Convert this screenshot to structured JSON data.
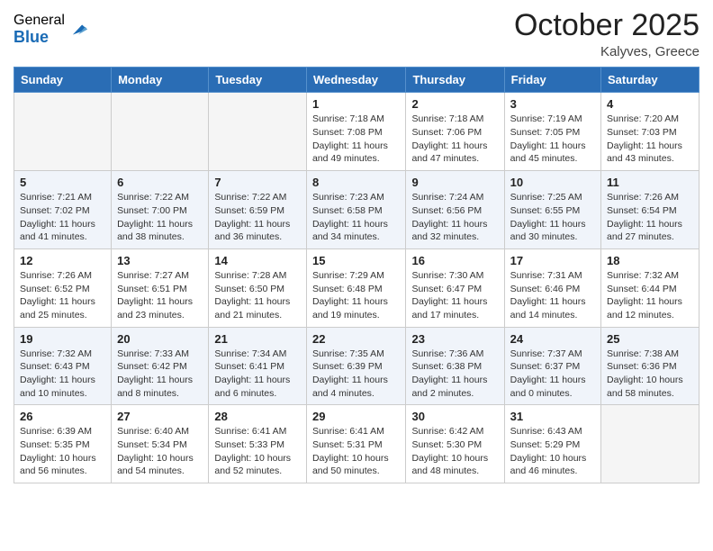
{
  "logo": {
    "general": "General",
    "blue": "Blue"
  },
  "header": {
    "month": "October 2025",
    "location": "Kalyves, Greece"
  },
  "weekdays": [
    "Sunday",
    "Monday",
    "Tuesday",
    "Wednesday",
    "Thursday",
    "Friday",
    "Saturday"
  ],
  "weeks": [
    [
      {
        "day": "",
        "sunrise": "",
        "sunset": "",
        "daylight": ""
      },
      {
        "day": "",
        "sunrise": "",
        "sunset": "",
        "daylight": ""
      },
      {
        "day": "",
        "sunrise": "",
        "sunset": "",
        "daylight": ""
      },
      {
        "day": "1",
        "sunrise": "Sunrise: 7:18 AM",
        "sunset": "Sunset: 7:08 PM",
        "daylight": "Daylight: 11 hours and 49 minutes."
      },
      {
        "day": "2",
        "sunrise": "Sunrise: 7:18 AM",
        "sunset": "Sunset: 7:06 PM",
        "daylight": "Daylight: 11 hours and 47 minutes."
      },
      {
        "day": "3",
        "sunrise": "Sunrise: 7:19 AM",
        "sunset": "Sunset: 7:05 PM",
        "daylight": "Daylight: 11 hours and 45 minutes."
      },
      {
        "day": "4",
        "sunrise": "Sunrise: 7:20 AM",
        "sunset": "Sunset: 7:03 PM",
        "daylight": "Daylight: 11 hours and 43 minutes."
      }
    ],
    [
      {
        "day": "5",
        "sunrise": "Sunrise: 7:21 AM",
        "sunset": "Sunset: 7:02 PM",
        "daylight": "Daylight: 11 hours and 41 minutes."
      },
      {
        "day": "6",
        "sunrise": "Sunrise: 7:22 AM",
        "sunset": "Sunset: 7:00 PM",
        "daylight": "Daylight: 11 hours and 38 minutes."
      },
      {
        "day": "7",
        "sunrise": "Sunrise: 7:22 AM",
        "sunset": "Sunset: 6:59 PM",
        "daylight": "Daylight: 11 hours and 36 minutes."
      },
      {
        "day": "8",
        "sunrise": "Sunrise: 7:23 AM",
        "sunset": "Sunset: 6:58 PM",
        "daylight": "Daylight: 11 hours and 34 minutes."
      },
      {
        "day": "9",
        "sunrise": "Sunrise: 7:24 AM",
        "sunset": "Sunset: 6:56 PM",
        "daylight": "Daylight: 11 hours and 32 minutes."
      },
      {
        "day": "10",
        "sunrise": "Sunrise: 7:25 AM",
        "sunset": "Sunset: 6:55 PM",
        "daylight": "Daylight: 11 hours and 30 minutes."
      },
      {
        "day": "11",
        "sunrise": "Sunrise: 7:26 AM",
        "sunset": "Sunset: 6:54 PM",
        "daylight": "Daylight: 11 hours and 27 minutes."
      }
    ],
    [
      {
        "day": "12",
        "sunrise": "Sunrise: 7:26 AM",
        "sunset": "Sunset: 6:52 PM",
        "daylight": "Daylight: 11 hours and 25 minutes."
      },
      {
        "day": "13",
        "sunrise": "Sunrise: 7:27 AM",
        "sunset": "Sunset: 6:51 PM",
        "daylight": "Daylight: 11 hours and 23 minutes."
      },
      {
        "day": "14",
        "sunrise": "Sunrise: 7:28 AM",
        "sunset": "Sunset: 6:50 PM",
        "daylight": "Daylight: 11 hours and 21 minutes."
      },
      {
        "day": "15",
        "sunrise": "Sunrise: 7:29 AM",
        "sunset": "Sunset: 6:48 PM",
        "daylight": "Daylight: 11 hours and 19 minutes."
      },
      {
        "day": "16",
        "sunrise": "Sunrise: 7:30 AM",
        "sunset": "Sunset: 6:47 PM",
        "daylight": "Daylight: 11 hours and 17 minutes."
      },
      {
        "day": "17",
        "sunrise": "Sunrise: 7:31 AM",
        "sunset": "Sunset: 6:46 PM",
        "daylight": "Daylight: 11 hours and 14 minutes."
      },
      {
        "day": "18",
        "sunrise": "Sunrise: 7:32 AM",
        "sunset": "Sunset: 6:44 PM",
        "daylight": "Daylight: 11 hours and 12 minutes."
      }
    ],
    [
      {
        "day": "19",
        "sunrise": "Sunrise: 7:32 AM",
        "sunset": "Sunset: 6:43 PM",
        "daylight": "Daylight: 11 hours and 10 minutes."
      },
      {
        "day": "20",
        "sunrise": "Sunrise: 7:33 AM",
        "sunset": "Sunset: 6:42 PM",
        "daylight": "Daylight: 11 hours and 8 minutes."
      },
      {
        "day": "21",
        "sunrise": "Sunrise: 7:34 AM",
        "sunset": "Sunset: 6:41 PM",
        "daylight": "Daylight: 11 hours and 6 minutes."
      },
      {
        "day": "22",
        "sunrise": "Sunrise: 7:35 AM",
        "sunset": "Sunset: 6:39 PM",
        "daylight": "Daylight: 11 hours and 4 minutes."
      },
      {
        "day": "23",
        "sunrise": "Sunrise: 7:36 AM",
        "sunset": "Sunset: 6:38 PM",
        "daylight": "Daylight: 11 hours and 2 minutes."
      },
      {
        "day": "24",
        "sunrise": "Sunrise: 7:37 AM",
        "sunset": "Sunset: 6:37 PM",
        "daylight": "Daylight: 11 hours and 0 minutes."
      },
      {
        "day": "25",
        "sunrise": "Sunrise: 7:38 AM",
        "sunset": "Sunset: 6:36 PM",
        "daylight": "Daylight: 10 hours and 58 minutes."
      }
    ],
    [
      {
        "day": "26",
        "sunrise": "Sunrise: 6:39 AM",
        "sunset": "Sunset: 5:35 PM",
        "daylight": "Daylight: 10 hours and 56 minutes."
      },
      {
        "day": "27",
        "sunrise": "Sunrise: 6:40 AM",
        "sunset": "Sunset: 5:34 PM",
        "daylight": "Daylight: 10 hours and 54 minutes."
      },
      {
        "day": "28",
        "sunrise": "Sunrise: 6:41 AM",
        "sunset": "Sunset: 5:33 PM",
        "daylight": "Daylight: 10 hours and 52 minutes."
      },
      {
        "day": "29",
        "sunrise": "Sunrise: 6:41 AM",
        "sunset": "Sunset: 5:31 PM",
        "daylight": "Daylight: 10 hours and 50 minutes."
      },
      {
        "day": "30",
        "sunrise": "Sunrise: 6:42 AM",
        "sunset": "Sunset: 5:30 PM",
        "daylight": "Daylight: 10 hours and 48 minutes."
      },
      {
        "day": "31",
        "sunrise": "Sunrise: 6:43 AM",
        "sunset": "Sunset: 5:29 PM",
        "daylight": "Daylight: 10 hours and 46 minutes."
      },
      {
        "day": "",
        "sunrise": "",
        "sunset": "",
        "daylight": ""
      }
    ]
  ]
}
